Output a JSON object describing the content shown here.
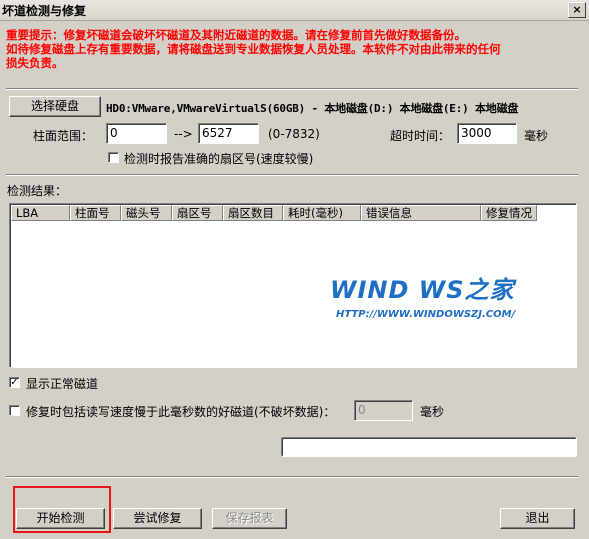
{
  "window": {
    "title": "坏道检测与修复",
    "close_label": "×"
  },
  "warning": {
    "line1": "重要提示：修复坏磁道会破坏坏磁道及其附近磁道的数据。请在修复前首先做好数据备份。",
    "line2": "如待修复磁盘上存有重要数据，请将磁盘送到专业数据恢复人员处理。本软件不对由此带来的任何",
    "line3": "损失负责。"
  },
  "disk": {
    "select_button": "选择硬盘",
    "info": "HD0:VMware,VMwareVirtualS(60GB) - 本地磁盘(D:) 本地磁盘(E:) 本地磁盘"
  },
  "range": {
    "label": "柱面范围：",
    "start": "0",
    "arrow": "-->",
    "end": "6527",
    "hint": "(0-7832)"
  },
  "timeout": {
    "label": "超时时间：",
    "value": "3000",
    "unit": "毫秒"
  },
  "options": {
    "report_sector_label": "检测时报告准确的扇区号(速度较慢)",
    "report_sector_checked": false,
    "show_normal_label": "显示正常磁道",
    "show_normal_checked": true,
    "include_slow_label": "修复时包括读写速度慢于此毫秒数的好磁道(不破坏数据)：",
    "include_slow_checked": false,
    "slow_value": "0",
    "slow_unit": "毫秒"
  },
  "results": {
    "label": "检测结果：",
    "columns": [
      "LBA",
      "柱面号",
      "磁头号",
      "扇区号",
      "扇区数目",
      "耗时(毫秒)",
      "错误信息",
      "修复情况"
    ],
    "rows": []
  },
  "watermark": {
    "logo": "WIND  WS之家",
    "url": "HTTP://WWW.WINDOWSZJ.COM/"
  },
  "buttons": {
    "start": "开始检测",
    "try_repair": "尝试修复",
    "save_report": "保存报表",
    "exit": "退出"
  },
  "colors": {
    "warning": "#ff0000",
    "highlight": "#e8141b",
    "watermark": "#1f6fc4",
    "face": "#d4d0c8"
  }
}
